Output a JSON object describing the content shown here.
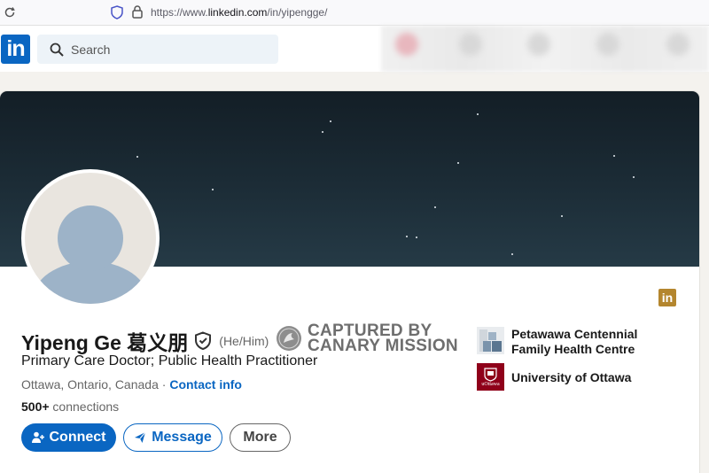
{
  "browser": {
    "url_prefix": "https://www.",
    "url_domain": "linkedin.com",
    "url_path": "/in/yipengge/"
  },
  "nav": {
    "logo_text": "in",
    "search_placeholder": "Search"
  },
  "profile": {
    "name": "Yipeng Ge 葛义朋",
    "pronouns": "(He/Him)",
    "headline": "Primary Care Doctor; Public Health Practitioner",
    "location": "Ottawa, Ontario, Canada",
    "location_sep": " · ",
    "contact_info_label": "Contact info",
    "connections_count": "500+",
    "connections_label": " connections",
    "corner_logo_text": "in"
  },
  "watermark": {
    "line1": "CAPTURED BY",
    "line2": "CANARY MISSION"
  },
  "actions": {
    "connect_label": "Connect",
    "message_label": "Message",
    "more_label": "More"
  },
  "organizations": [
    {
      "name": "Petawawa Centennial Family Health Centre"
    },
    {
      "name": "University of Ottawa",
      "logo_text": "uOttawa"
    }
  ],
  "colors": {
    "brand": "#0a66c2",
    "banner": "#1b2b35",
    "uottawa": "#8f001a"
  }
}
